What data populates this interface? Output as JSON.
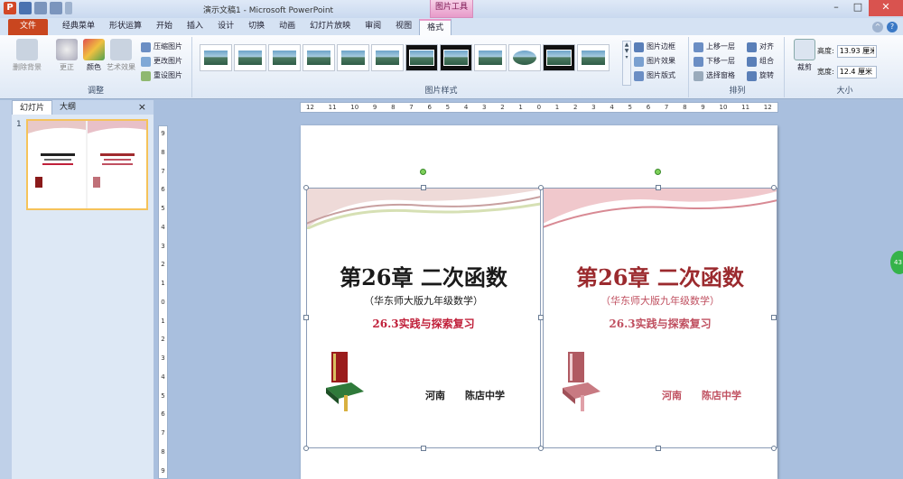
{
  "app": {
    "window_title": "演示文稿1 - Microsoft PowerPoint",
    "context_tab_group": "图片工具"
  },
  "tabs": [
    "文件",
    "经典菜单",
    "形状运算",
    "开始",
    "插入",
    "设计",
    "切换",
    "动画",
    "幻灯片放映",
    "审阅",
    "视图",
    "格式"
  ],
  "active_tab": "格式",
  "ribbon": {
    "adjust": {
      "label": "调整",
      "remove_bg": "删除背景",
      "correct": "更正",
      "color": "颜色",
      "art": "艺术效果",
      "compress": "压缩图片",
      "change": "更改图片",
      "reset": "重设图片"
    },
    "styles": {
      "label": "图片样式",
      "border": "图片边框",
      "effects": "图片效果",
      "layout": "图片版式"
    },
    "arrange": {
      "label": "排列",
      "bring_forward": "上移一层",
      "send_backward": "下移一层",
      "selection_pane": "选择窗格",
      "align": "对齐",
      "group": "组合",
      "rotate": "旋转"
    },
    "size": {
      "label": "大小",
      "crop": "裁剪",
      "height_label": "高度:",
      "height_value": "13.93 厘米",
      "width_label": "宽度:",
      "width_value": "12.4 厘米"
    }
  },
  "panel": {
    "tab_slides": "幻灯片",
    "tab_outline": "大纲",
    "close": "×",
    "slide_number": "1"
  },
  "ruler": {
    "h": [
      "12",
      "11",
      "10",
      "9",
      "8",
      "7",
      "6",
      "5",
      "4",
      "3",
      "2",
      "1",
      "0",
      "1",
      "2",
      "3",
      "4",
      "5",
      "6",
      "7",
      "8",
      "9",
      "10",
      "11",
      "12"
    ],
    "v": [
      "9",
      "8",
      "7",
      "6",
      "5",
      "4",
      "3",
      "2",
      "1",
      "0",
      "1",
      "2",
      "3",
      "4",
      "5",
      "6",
      "7",
      "8",
      "9"
    ]
  },
  "slide": {
    "chapter_num": "26",
    "chapter_pre": "第",
    "chapter_post": "章 二次函数",
    "subtitle": "（华东师大版九年级数学）",
    "section": "26.3实践与探索复习",
    "province": "河南",
    "school": "陈店中学",
    "colors": {
      "black": "#1a1a1a",
      "red": "#c0203a",
      "dark_red": "#9b2a2e",
      "pink": "#c05060"
    }
  },
  "status_badge": "43"
}
